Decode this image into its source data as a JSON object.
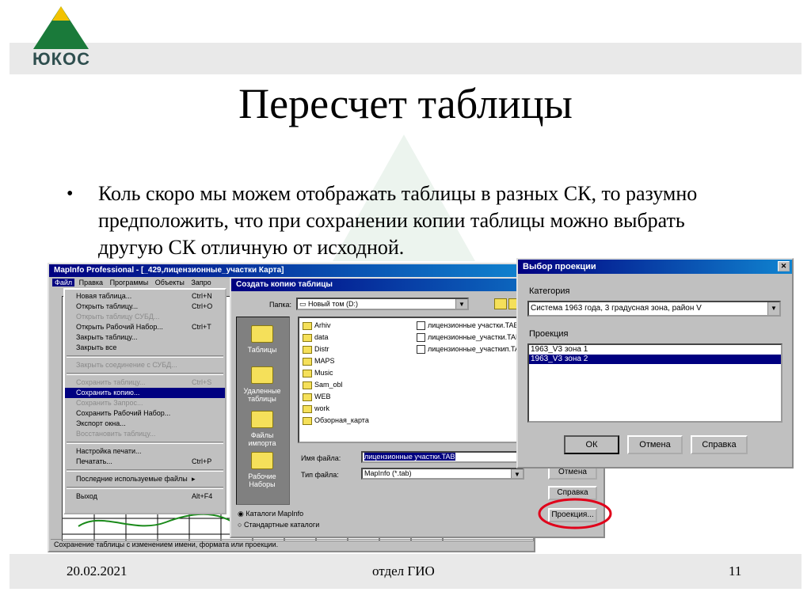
{
  "slide": {
    "logo_text": "ЮКОС",
    "title": "Пересчет таблицы",
    "bullet": "•",
    "body": "Коль скоро мы можем отображать таблицы в разных СК, то разумно предположить, что при сохранении копии таблицы можно выбрать другую СК отличную от исходной.",
    "footer_date": "20.02.2021",
    "footer_center": "отдел ГИО",
    "footer_page": "11"
  },
  "mapinfo": {
    "title": "MapInfo Professional - [_429,лицензионные_участки Карта]",
    "menubar": [
      "Файл",
      "Правка",
      "Программы",
      "Объекты",
      "Запро"
    ],
    "file_menu": [
      {
        "label": "Новая таблица...",
        "shortcut": "Ctrl+N",
        "state": "normal"
      },
      {
        "label": "Открыть таблицу...",
        "shortcut": "Ctrl+O",
        "state": "normal"
      },
      {
        "label": "Открыть таблицу СУБД...",
        "shortcut": "",
        "state": "disabled"
      },
      {
        "label": "Открыть Рабочий Набор...",
        "shortcut": "Ctrl+T",
        "state": "normal"
      },
      {
        "label": "Закрыть таблицу...",
        "shortcut": "",
        "state": "normal"
      },
      {
        "label": "Закрыть все",
        "shortcut": "",
        "state": "normal"
      },
      {
        "sep": true
      },
      {
        "label": "Закрыть соединение с СУБД...",
        "shortcut": "",
        "state": "disabled"
      },
      {
        "sep": true
      },
      {
        "label": "Сохранить таблицу...",
        "shortcut": "Ctrl+S",
        "state": "disabled"
      },
      {
        "label": "Сохранить копию...",
        "shortcut": "",
        "state": "sel"
      },
      {
        "label": "Сохранить Запрос...",
        "shortcut": "",
        "state": "disabled"
      },
      {
        "label": "Сохранить Рабочий Набор...",
        "shortcut": "",
        "state": "normal"
      },
      {
        "label": "Экспорт окна...",
        "shortcut": "",
        "state": "normal"
      },
      {
        "label": "Восстановить таблицу...",
        "shortcut": "",
        "state": "disabled"
      },
      {
        "sep": true
      },
      {
        "label": "Настройка печати...",
        "shortcut": "",
        "state": "normal"
      },
      {
        "label": "Печатать...",
        "shortcut": "Ctrl+P",
        "state": "normal"
      },
      {
        "sep": true
      },
      {
        "label": "Последние используемые файлы",
        "shortcut": "▸",
        "state": "normal"
      },
      {
        "sep": true
      },
      {
        "label": "Выход",
        "shortcut": "Alt+F4",
        "state": "normal"
      }
    ],
    "status": "Сохранение таблицы с изменением имени, формата или проекции."
  },
  "copy_dialog": {
    "title": "Создать копию таблицы",
    "folder_label": "Папка:",
    "folder_value": "Новый том (D:)",
    "places": [
      "Таблицы",
      "Удаленные таблицы",
      "Файлы импорта",
      "Рабочие Наборы"
    ],
    "folders": [
      "Arhiv",
      "data",
      "Distr",
      "MAPS",
      "Music",
      "Sam_obl",
      "WEB",
      "work",
      "Обзорная_карта"
    ],
    "files": [
      "лицензионные участки.TAB",
      "лицензионные_участки.TAB",
      "лицензионные_участкип.TAB"
    ],
    "filename_label": "Имя файла:",
    "filename_value": "лицензионные участки.TAB",
    "filetype_label": "Тип файла:",
    "filetype_value": "MapInfo (*.tab)",
    "radio_mapinfo": "Каталоги MapInfo",
    "radio_standard": "Стандартные каталоги",
    "btn_cancel": "Отмена",
    "btn_help": "Справка",
    "btn_projection": "Проекция..."
  },
  "projection_dialog": {
    "title": "Выбор проекции",
    "close": "✕",
    "category_label": "Категория",
    "category_value": "Система 1963 года, 3 градусная зона, район V",
    "projection_label": "Проекция",
    "projections": [
      {
        "label": "1963_V3 зона 1",
        "selected": false
      },
      {
        "label": "1963_V3 зона 2",
        "selected": true
      }
    ],
    "btn_ok": "ОК",
    "btn_cancel": "Отмена",
    "btn_help": "Справка"
  },
  "colors": {
    "title_bar": "#000080",
    "highlight_circle": "#e0001a",
    "logo_green": "#1a7a3a",
    "logo_yellow": "#f2c200"
  }
}
